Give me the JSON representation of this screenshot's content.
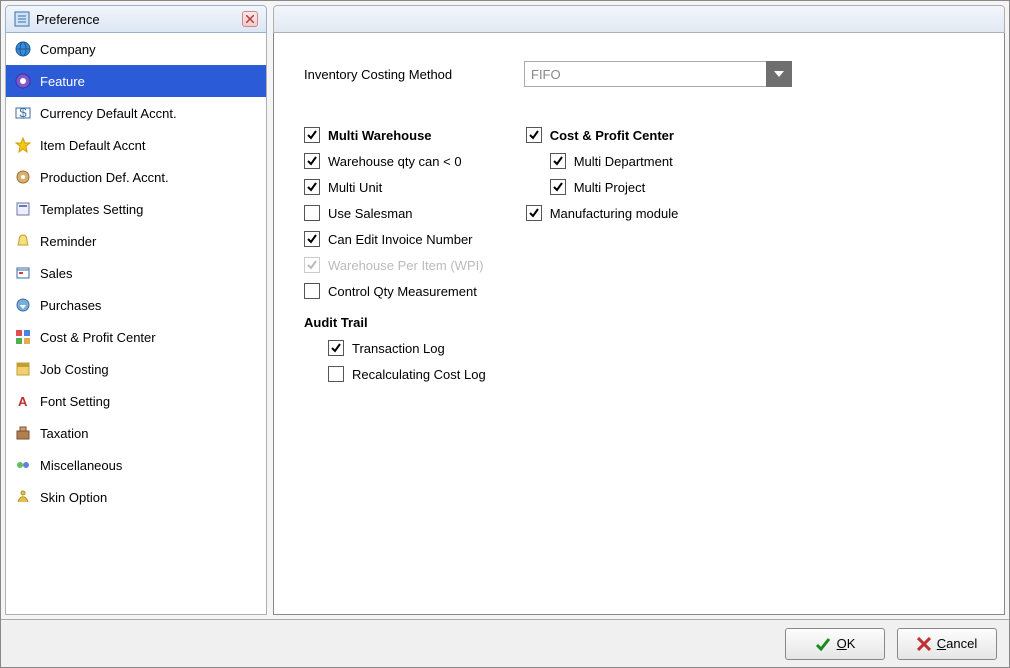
{
  "tab": {
    "title": "Preference"
  },
  "sidebar": {
    "items": [
      {
        "label": "Company",
        "icon": "globe-icon"
      },
      {
        "label": "Feature",
        "icon": "feature-icon",
        "selected": true
      },
      {
        "label": "Currency Default Accnt.",
        "icon": "currency-icon"
      },
      {
        "label": "Item Default Accnt",
        "icon": "star-icon"
      },
      {
        "label": "Production Def. Accnt.",
        "icon": "production-icon"
      },
      {
        "label": "Templates Setting",
        "icon": "template-icon"
      },
      {
        "label": "Reminder",
        "icon": "reminder-icon"
      },
      {
        "label": "Sales",
        "icon": "sales-icon"
      },
      {
        "label": "Purchases",
        "icon": "purchases-icon"
      },
      {
        "label": "Cost & Profit Center",
        "icon": "grid-icon"
      },
      {
        "label": "Job Costing",
        "icon": "job-icon"
      },
      {
        "label": "Font Setting",
        "icon": "font-icon"
      },
      {
        "label": "Taxation",
        "icon": "tax-icon"
      },
      {
        "label": "Miscellaneous",
        "icon": "misc-icon"
      },
      {
        "label": "Skin Option",
        "icon": "skin-icon"
      }
    ]
  },
  "main": {
    "costing_label": "Inventory Costing Method",
    "costing_value": "FIFO",
    "left": {
      "multi_warehouse": "Multi Warehouse",
      "wh_qty_neg": "Warehouse qty can < 0",
      "multi_unit": "Multi Unit",
      "use_salesman": "Use Salesman",
      "can_edit_inv": "Can Edit Invoice Number",
      "wpi": "Warehouse Per Item (WPI)",
      "ctrl_qty_meas": "Control Qty Measurement",
      "audit_trail": "Audit Trail",
      "transaction_log": "Transaction Log",
      "recalc_cost_log": "Recalculating Cost Log"
    },
    "right": {
      "cost_profit_center": "Cost & Profit Center",
      "multi_dept": "Multi Department",
      "multi_project": "Multi Project",
      "manufacturing": "Manufacturing module"
    }
  },
  "buttons": {
    "ok_letter": "O",
    "ok_rest": "K",
    "cancel_letter": "C",
    "cancel_rest": "ancel"
  }
}
